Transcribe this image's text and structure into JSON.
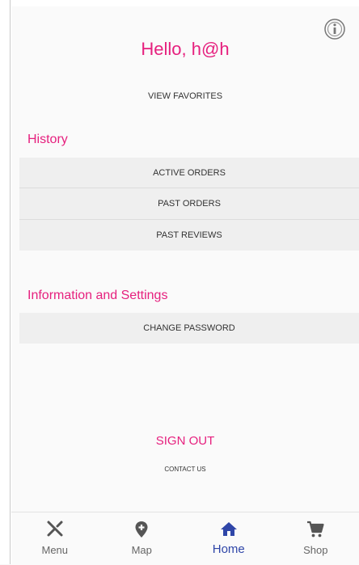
{
  "header": {
    "greeting": "Hello, h@h",
    "info_icon": "info-icon"
  },
  "favorites": {
    "label": "VIEW FAVORITES"
  },
  "history": {
    "title": "History",
    "items": [
      {
        "label": "ACTIVE ORDERS"
      },
      {
        "label": "PAST ORDERS"
      },
      {
        "label": "PAST REVIEWS"
      }
    ]
  },
  "settings": {
    "title": "Information and Settings",
    "items": [
      {
        "label": "CHANGE PASSWORD"
      }
    ]
  },
  "footer": {
    "sign_out": "SIGN OUT",
    "contact": "CONTACT US"
  },
  "bottom_nav": {
    "items": [
      {
        "label": "Menu",
        "icon": "fork-knife-icon"
      },
      {
        "label": "Map",
        "icon": "map-pin-icon"
      },
      {
        "label": "Home",
        "icon": "home-icon",
        "active": true
      },
      {
        "label": "Shop",
        "icon": "cart-icon"
      }
    ]
  },
  "colors": {
    "accent": "#e6207e",
    "active_nav": "#2f46a8",
    "row_bg": "#efefef"
  }
}
